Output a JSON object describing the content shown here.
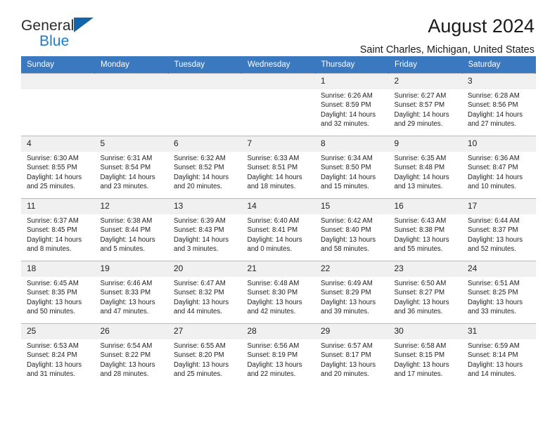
{
  "brand": {
    "name_part1": "General",
    "name_part2": "Blue",
    "triangle_color": "#1165a8",
    "blue": "#1e7ac4"
  },
  "header": {
    "title": "August 2024",
    "location": "Saint Charles, Michigan, United States",
    "accent_color": "#3a78bf",
    "daynum_band_color": "#f0f0f0"
  },
  "weekday_headers": [
    "Sunday",
    "Monday",
    "Tuesday",
    "Wednesday",
    "Thursday",
    "Friday",
    "Saturday"
  ],
  "labels": {
    "sunrise": "Sunrise:",
    "sunset": "Sunset:",
    "daylight": "Daylight:"
  },
  "weeks": [
    [
      {
        "day": ""
      },
      {
        "day": ""
      },
      {
        "day": ""
      },
      {
        "day": ""
      },
      {
        "day": "1",
        "sunrise": "Sunrise: 6:26 AM",
        "sunset": "Sunset: 8:59 PM",
        "daylight_line1": "Daylight: 14 hours",
        "daylight_line2": "and 32 minutes."
      },
      {
        "day": "2",
        "sunrise": "Sunrise: 6:27 AM",
        "sunset": "Sunset: 8:57 PM",
        "daylight_line1": "Daylight: 14 hours",
        "daylight_line2": "and 29 minutes."
      },
      {
        "day": "3",
        "sunrise": "Sunrise: 6:28 AM",
        "sunset": "Sunset: 8:56 PM",
        "daylight_line1": "Daylight: 14 hours",
        "daylight_line2": "and 27 minutes."
      }
    ],
    [
      {
        "day": "4",
        "sunrise": "Sunrise: 6:30 AM",
        "sunset": "Sunset: 8:55 PM",
        "daylight_line1": "Daylight: 14 hours",
        "daylight_line2": "and 25 minutes."
      },
      {
        "day": "5",
        "sunrise": "Sunrise: 6:31 AM",
        "sunset": "Sunset: 8:54 PM",
        "daylight_line1": "Daylight: 14 hours",
        "daylight_line2": "and 23 minutes."
      },
      {
        "day": "6",
        "sunrise": "Sunrise: 6:32 AM",
        "sunset": "Sunset: 8:52 PM",
        "daylight_line1": "Daylight: 14 hours",
        "daylight_line2": "and 20 minutes."
      },
      {
        "day": "7",
        "sunrise": "Sunrise: 6:33 AM",
        "sunset": "Sunset: 8:51 PM",
        "daylight_line1": "Daylight: 14 hours",
        "daylight_line2": "and 18 minutes."
      },
      {
        "day": "8",
        "sunrise": "Sunrise: 6:34 AM",
        "sunset": "Sunset: 8:50 PM",
        "daylight_line1": "Daylight: 14 hours",
        "daylight_line2": "and 15 minutes."
      },
      {
        "day": "9",
        "sunrise": "Sunrise: 6:35 AM",
        "sunset": "Sunset: 8:48 PM",
        "daylight_line1": "Daylight: 14 hours",
        "daylight_line2": "and 13 minutes."
      },
      {
        "day": "10",
        "sunrise": "Sunrise: 6:36 AM",
        "sunset": "Sunset: 8:47 PM",
        "daylight_line1": "Daylight: 14 hours",
        "daylight_line2": "and 10 minutes."
      }
    ],
    [
      {
        "day": "11",
        "sunrise": "Sunrise: 6:37 AM",
        "sunset": "Sunset: 8:45 PM",
        "daylight_line1": "Daylight: 14 hours",
        "daylight_line2": "and 8 minutes."
      },
      {
        "day": "12",
        "sunrise": "Sunrise: 6:38 AM",
        "sunset": "Sunset: 8:44 PM",
        "daylight_line1": "Daylight: 14 hours",
        "daylight_line2": "and 5 minutes."
      },
      {
        "day": "13",
        "sunrise": "Sunrise: 6:39 AM",
        "sunset": "Sunset: 8:43 PM",
        "daylight_line1": "Daylight: 14 hours",
        "daylight_line2": "and 3 minutes."
      },
      {
        "day": "14",
        "sunrise": "Sunrise: 6:40 AM",
        "sunset": "Sunset: 8:41 PM",
        "daylight_line1": "Daylight: 14 hours",
        "daylight_line2": "and 0 minutes."
      },
      {
        "day": "15",
        "sunrise": "Sunrise: 6:42 AM",
        "sunset": "Sunset: 8:40 PM",
        "daylight_line1": "Daylight: 13 hours",
        "daylight_line2": "and 58 minutes."
      },
      {
        "day": "16",
        "sunrise": "Sunrise: 6:43 AM",
        "sunset": "Sunset: 8:38 PM",
        "daylight_line1": "Daylight: 13 hours",
        "daylight_line2": "and 55 minutes."
      },
      {
        "day": "17",
        "sunrise": "Sunrise: 6:44 AM",
        "sunset": "Sunset: 8:37 PM",
        "daylight_line1": "Daylight: 13 hours",
        "daylight_line2": "and 52 minutes."
      }
    ],
    [
      {
        "day": "18",
        "sunrise": "Sunrise: 6:45 AM",
        "sunset": "Sunset: 8:35 PM",
        "daylight_line1": "Daylight: 13 hours",
        "daylight_line2": "and 50 minutes."
      },
      {
        "day": "19",
        "sunrise": "Sunrise: 6:46 AM",
        "sunset": "Sunset: 8:33 PM",
        "daylight_line1": "Daylight: 13 hours",
        "daylight_line2": "and 47 minutes."
      },
      {
        "day": "20",
        "sunrise": "Sunrise: 6:47 AM",
        "sunset": "Sunset: 8:32 PM",
        "daylight_line1": "Daylight: 13 hours",
        "daylight_line2": "and 44 minutes."
      },
      {
        "day": "21",
        "sunrise": "Sunrise: 6:48 AM",
        "sunset": "Sunset: 8:30 PM",
        "daylight_line1": "Daylight: 13 hours",
        "daylight_line2": "and 42 minutes."
      },
      {
        "day": "22",
        "sunrise": "Sunrise: 6:49 AM",
        "sunset": "Sunset: 8:29 PM",
        "daylight_line1": "Daylight: 13 hours",
        "daylight_line2": "and 39 minutes."
      },
      {
        "day": "23",
        "sunrise": "Sunrise: 6:50 AM",
        "sunset": "Sunset: 8:27 PM",
        "daylight_line1": "Daylight: 13 hours",
        "daylight_line2": "and 36 minutes."
      },
      {
        "day": "24",
        "sunrise": "Sunrise: 6:51 AM",
        "sunset": "Sunset: 8:25 PM",
        "daylight_line1": "Daylight: 13 hours",
        "daylight_line2": "and 33 minutes."
      }
    ],
    [
      {
        "day": "25",
        "sunrise": "Sunrise: 6:53 AM",
        "sunset": "Sunset: 8:24 PM",
        "daylight_line1": "Daylight: 13 hours",
        "daylight_line2": "and 31 minutes."
      },
      {
        "day": "26",
        "sunrise": "Sunrise: 6:54 AM",
        "sunset": "Sunset: 8:22 PM",
        "daylight_line1": "Daylight: 13 hours",
        "daylight_line2": "and 28 minutes."
      },
      {
        "day": "27",
        "sunrise": "Sunrise: 6:55 AM",
        "sunset": "Sunset: 8:20 PM",
        "daylight_line1": "Daylight: 13 hours",
        "daylight_line2": "and 25 minutes."
      },
      {
        "day": "28",
        "sunrise": "Sunrise: 6:56 AM",
        "sunset": "Sunset: 8:19 PM",
        "daylight_line1": "Daylight: 13 hours",
        "daylight_line2": "and 22 minutes."
      },
      {
        "day": "29",
        "sunrise": "Sunrise: 6:57 AM",
        "sunset": "Sunset: 8:17 PM",
        "daylight_line1": "Daylight: 13 hours",
        "daylight_line2": "and 20 minutes."
      },
      {
        "day": "30",
        "sunrise": "Sunrise: 6:58 AM",
        "sunset": "Sunset: 8:15 PM",
        "daylight_line1": "Daylight: 13 hours",
        "daylight_line2": "and 17 minutes."
      },
      {
        "day": "31",
        "sunrise": "Sunrise: 6:59 AM",
        "sunset": "Sunset: 8:14 PM",
        "daylight_line1": "Daylight: 13 hours",
        "daylight_line2": "and 14 minutes."
      }
    ]
  ]
}
